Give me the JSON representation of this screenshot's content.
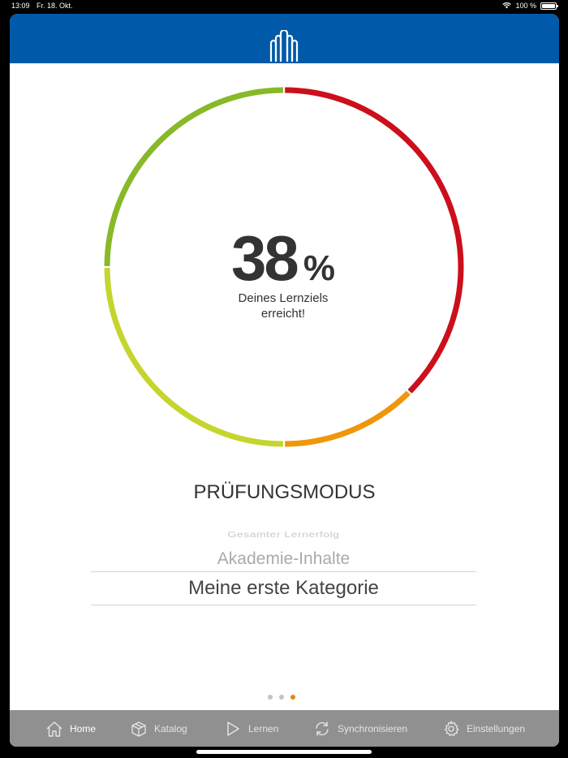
{
  "status_bar": {
    "time": "13:09",
    "date": "Fr. 18. Okt.",
    "battery": "100 %",
    "battery_level": 1.0,
    "icons": [
      "wifi-icon",
      "battery-icon"
    ]
  },
  "header": {
    "brand_color": "#005aa9",
    "logo_icon": "building-pillars-icon"
  },
  "progress": {
    "value": "38",
    "unit": "%",
    "caption_line1": "Deines Lernziels",
    "caption_line2": "erreicht!",
    "segments": [
      {
        "color": "#cc0f1c",
        "fraction": 0.375
      },
      {
        "color": "#f0960a",
        "fraction": 0.125
      },
      {
        "color": "#c5d52e",
        "fraction": 0.25
      },
      {
        "color": "#87b928",
        "fraction": 0.25
      }
    ]
  },
  "mode": {
    "title": "PRÜFUNGSMODUS"
  },
  "picker": {
    "options": [
      "Gesamter Lernerfolg",
      "Akademie-Inhalte",
      "Meine erste Kategorie"
    ],
    "selected": "Meine erste Kategorie"
  },
  "pager": {
    "count": 3,
    "active_index": 2,
    "active_color": "#e8831a"
  },
  "tabbar": {
    "background": "#909090",
    "tabs": [
      {
        "label": "Home",
        "icon": "home-icon",
        "active": true
      },
      {
        "label": "Katalog",
        "icon": "box-icon",
        "active": false
      },
      {
        "label": "Lernen",
        "icon": "play-icon",
        "active": false
      },
      {
        "label": "Synchronisieren",
        "icon": "sync-icon",
        "active": false
      },
      {
        "label": "Einstellungen",
        "icon": "gear-icon",
        "active": false
      }
    ]
  }
}
